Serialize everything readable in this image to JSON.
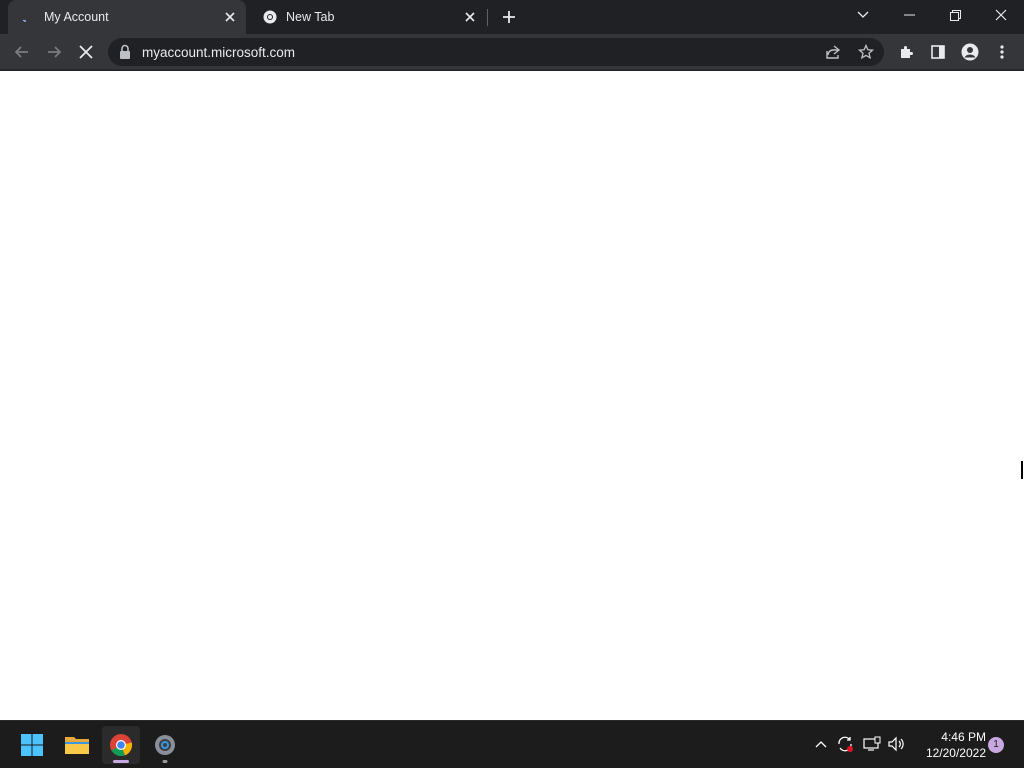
{
  "browser": {
    "tabs": [
      {
        "title": "My Account",
        "active": true,
        "favicon": "loading-spinner-icon"
      },
      {
        "title": "New Tab",
        "active": false,
        "favicon": "chrome-icon"
      }
    ],
    "address": {
      "url": "myaccount.microsoft.com"
    }
  },
  "taskbar": {
    "apps": [
      "start-icon",
      "file-explorer-icon",
      "chrome-icon",
      "settings-icon"
    ],
    "clock": {
      "time": "4:46 PM",
      "date": "12/20/2022"
    },
    "notification_count": "1"
  },
  "colors": {
    "accent": "#c7a8e0",
    "tabstrip": "#202124",
    "toolbar": "#35363a"
  }
}
